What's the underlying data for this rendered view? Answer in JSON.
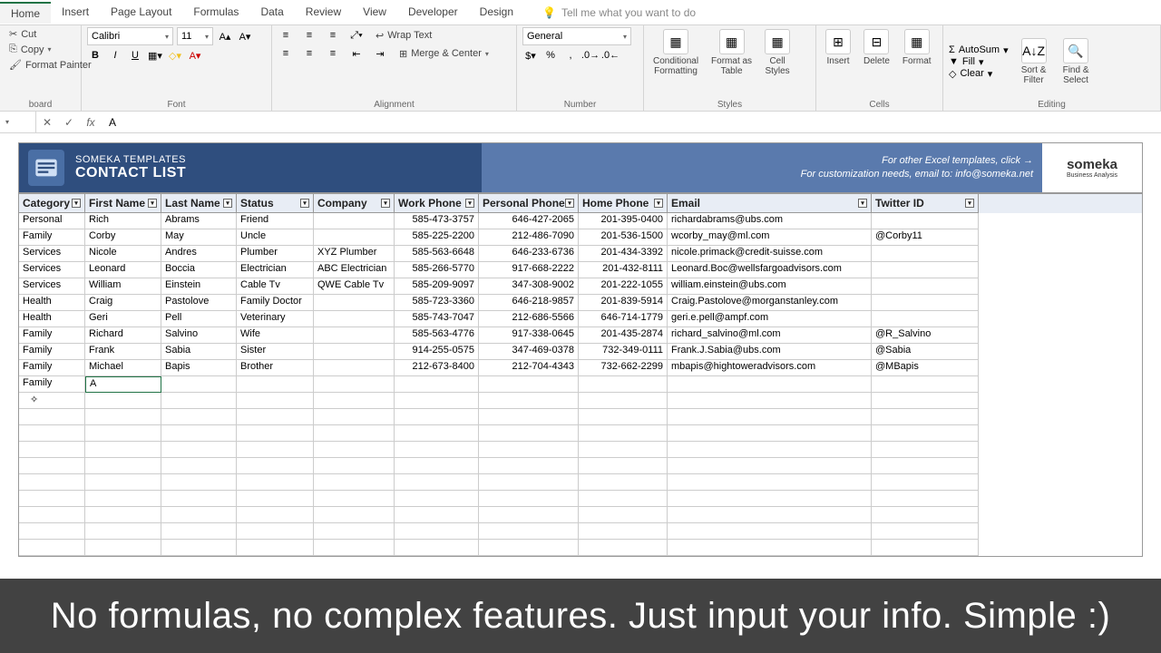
{
  "ribbon": {
    "tabs": [
      "Home",
      "Insert",
      "Page Layout",
      "Formulas",
      "Data",
      "Review",
      "View",
      "Developer",
      "Design"
    ],
    "active_tab": "Home",
    "tell_me": "Tell me what you want to do"
  },
  "clipboard": {
    "cut": "Cut",
    "copy": "Copy",
    "fp": "Format Painter",
    "label": "board"
  },
  "font": {
    "name": "Calibri",
    "size": "11",
    "bold": "B",
    "italic": "I",
    "underline": "U",
    "label": "Font"
  },
  "align": {
    "wrap": "Wrap Text",
    "merge": "Merge & Center",
    "label": "Alignment"
  },
  "number": {
    "format": "General",
    "label": "Number"
  },
  "styles": {
    "cf": "Conditional\nFormatting",
    "ft": "Format as\nTable",
    "cs": "Cell\nStyles",
    "label": "Styles"
  },
  "cells": {
    "ins": "Insert",
    "del": "Delete",
    "fmt": "Format",
    "label": "Cells"
  },
  "editing": {
    "sum": "AutoSum",
    "fill": "Fill",
    "clear": "Clear",
    "sort": "Sort &\nFilter",
    "find": "Find &\nSelect",
    "label": "Editing"
  },
  "formula_bar": {
    "value": "A"
  },
  "template": {
    "brand": "SOMEKA TEMPLATES",
    "title": "CONTACT LIST",
    "other": "For other Excel templates, click →",
    "custom": "For customization needs, email to: info@someka.net",
    "logo": "someka",
    "logo_sub": "Business Analysis"
  },
  "headers": [
    "Category",
    "First Name",
    "Last Name",
    "Status",
    "Company",
    "Work Phone",
    "Personal Phone",
    "Home Phone",
    "Email",
    "Twitter ID"
  ],
  "rows": [
    [
      "Personal",
      "Rich",
      "Abrams",
      "Friend",
      "",
      "585-473-3757",
      "646-427-2065",
      "201-395-0400",
      "richardabrams@ubs.com",
      ""
    ],
    [
      "Family",
      "Corby",
      "May",
      "Uncle",
      "",
      "585-225-2200",
      "212-486-7090",
      "201-536-1500",
      "wcorby_may@ml.com",
      "@Corby11"
    ],
    [
      "Services",
      "Nicole",
      "Andres",
      "Plumber",
      "XYZ Plumber",
      "585-563-6648",
      "646-233-6736",
      "201-434-3392",
      "nicole.primack@credit-suisse.com",
      ""
    ],
    [
      "Services",
      "Leonard",
      "Boccia",
      "Electrician",
      "ABC Electrician",
      "585-266-5770",
      "917-668-2222",
      "201-432-8111",
      "Leonard.Boc@wellsfargoadvisors.com",
      ""
    ],
    [
      "Services",
      "William",
      "Einstein",
      "Cable Tv",
      "QWE Cable Tv",
      "585-209-9097",
      "347-308-9002",
      "201-222-1055",
      "william.einstein@ubs.com",
      ""
    ],
    [
      "Health",
      "Craig",
      "Pastolove",
      "Family Doctor",
      "",
      "585-723-3360",
      "646-218-9857",
      "201-839-5914",
      "Craig.Pastolove@morganstanley.com",
      ""
    ],
    [
      "Health",
      "Geri",
      "Pell",
      "Veterinary",
      "",
      "585-743-7047",
      "212-686-5566",
      "646-714-1779",
      "geri.e.pell@ampf.com",
      ""
    ],
    [
      "Family",
      "Richard",
      "Salvino",
      "Wife",
      "",
      "585-563-4776",
      "917-338-0645",
      "201-435-2874",
      "richard_salvino@ml.com",
      "@R_Salvino"
    ],
    [
      "Family",
      "Frank",
      "Sabia",
      "Sister",
      "",
      "914-255-0575",
      "347-469-0378",
      "732-349-0111",
      "Frank.J.Sabia@ubs.com",
      "@Sabia"
    ],
    [
      "Family",
      "Michael",
      "Bapis",
      "Brother",
      "",
      "212-673-8400",
      "212-704-4343",
      "732-662-2299",
      "mbapis@hightoweradvisors.com",
      "@MBapis"
    ],
    [
      "Family",
      "A",
      "",
      "",
      "",
      "",
      "",
      "",
      "",
      ""
    ]
  ],
  "empty_rows": 10,
  "caption": "No formulas, no complex features. Just input your info. Simple :)"
}
